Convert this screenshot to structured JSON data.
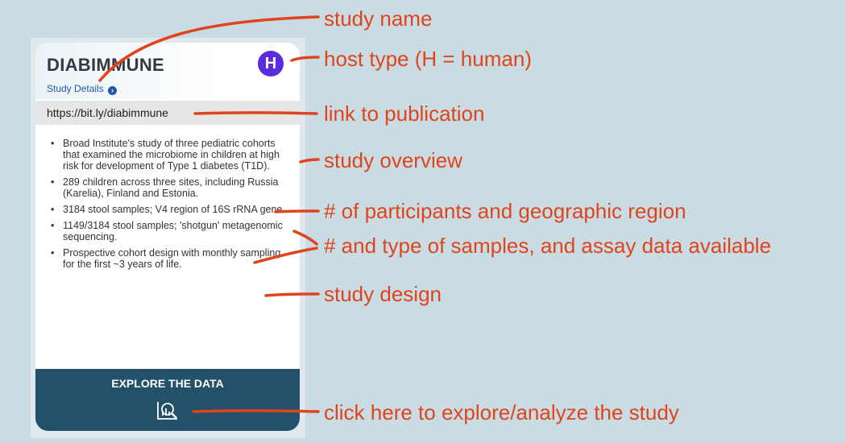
{
  "card": {
    "title": "DIABIMMUNE",
    "details_link": "Study Details",
    "host_badge": "H",
    "publication_link": "https://bit.ly/diabimmune",
    "overview_items": [
      "Broad Institute's study of three pediatric cohorts that examined the microbiome in children at high risk for development of Type 1 diabetes (T1D).",
      "289 children across three sites, including Russia (Karelia), Finland and Estonia.",
      "3184 stool samples; V4 region of 16S rRNA gene.",
      "1149/3184 stool samples; 'shotgun' metagenomic sequencing.",
      "Prospective cohort design with monthly sampling for the first ~3 years of life."
    ],
    "explore_label": "EXPLORE THE DATA"
  },
  "callouts": {
    "study_name": "study name",
    "host_type": "host type (H = human)",
    "publication": "link to publication",
    "overview": "study overview",
    "participants": "# of participants and geographic region",
    "samples": "# and type of samples, and assay data available",
    "design": "study design",
    "explore": "click here to explore/analyze the study"
  },
  "colors": {
    "background": "#c9dce3",
    "annotation": "#e0441c",
    "host_badge": "#5b2be0",
    "footer": "#23516a",
    "link": "#1e5aa8"
  },
  "icons": {
    "details": "chevron-right-circle-icon",
    "explore": "chart-magnifier-icon"
  }
}
